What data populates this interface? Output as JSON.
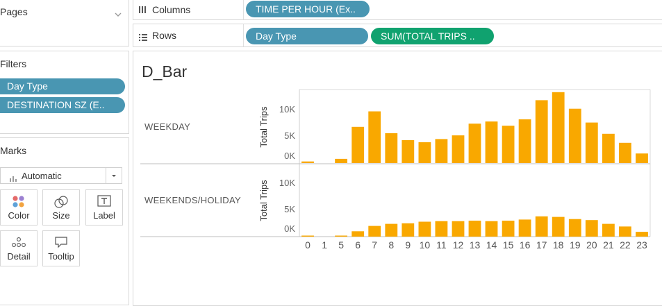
{
  "left_panel": {
    "pages": {
      "title": "Pages"
    },
    "filters": {
      "title": "Filters",
      "items": [
        "Day Type",
        "DESTINATION SZ (E.."
      ]
    },
    "marks": {
      "title": "Marks",
      "mark_type": "Automatic",
      "buttons": [
        "Color",
        "Size",
        "Label",
        "Detail",
        "Tooltip"
      ]
    }
  },
  "shelves": {
    "columns": {
      "label": "Columns",
      "pills": [
        "TIME PER HOUR (Ex.."
      ]
    },
    "rows": {
      "label": "Rows",
      "pills": [
        "Day Type",
        "SUM(TOTAL TRIPS .."
      ]
    }
  },
  "view": {
    "title": "D_Bar",
    "colors": {
      "bar": "#f9a800",
      "blue_pill": "#4996b2",
      "green_pill": "#10a26f"
    }
  },
  "chart_data": {
    "type": "bar",
    "title": "D_Bar",
    "ylabel": "Total Trips",
    "ylim": [
      0,
      13000
    ],
    "yticks": [
      "10K",
      "5K",
      "0K"
    ],
    "ytick_values": [
      10000,
      5000,
      0
    ],
    "categories": [
      "0",
      "1",
      "5",
      "6",
      "7",
      "8",
      "9",
      "10",
      "11",
      "12",
      "13",
      "14",
      "15",
      "16",
      "17",
      "18",
      "19",
      "20",
      "21",
      "22",
      "23"
    ],
    "series": [
      {
        "name": "WEEKDAY",
        "values": [
          300,
          0,
          800,
          6800,
          9700,
          5600,
          4300,
          3900,
          4500,
          5200,
          7400,
          7800,
          7000,
          8200,
          11800,
          13300,
          10200,
          7600,
          5500,
          3800,
          1800
        ]
      },
      {
        "name": "WEEKENDS/HOLIDAY",
        "values": [
          150,
          0,
          200,
          1000,
          2000,
          2400,
          2500,
          2800,
          2900,
          2900,
          3000,
          2900,
          3000,
          3200,
          3800,
          3700,
          3300,
          3100,
          2400,
          1900,
          900
        ]
      }
    ]
  }
}
